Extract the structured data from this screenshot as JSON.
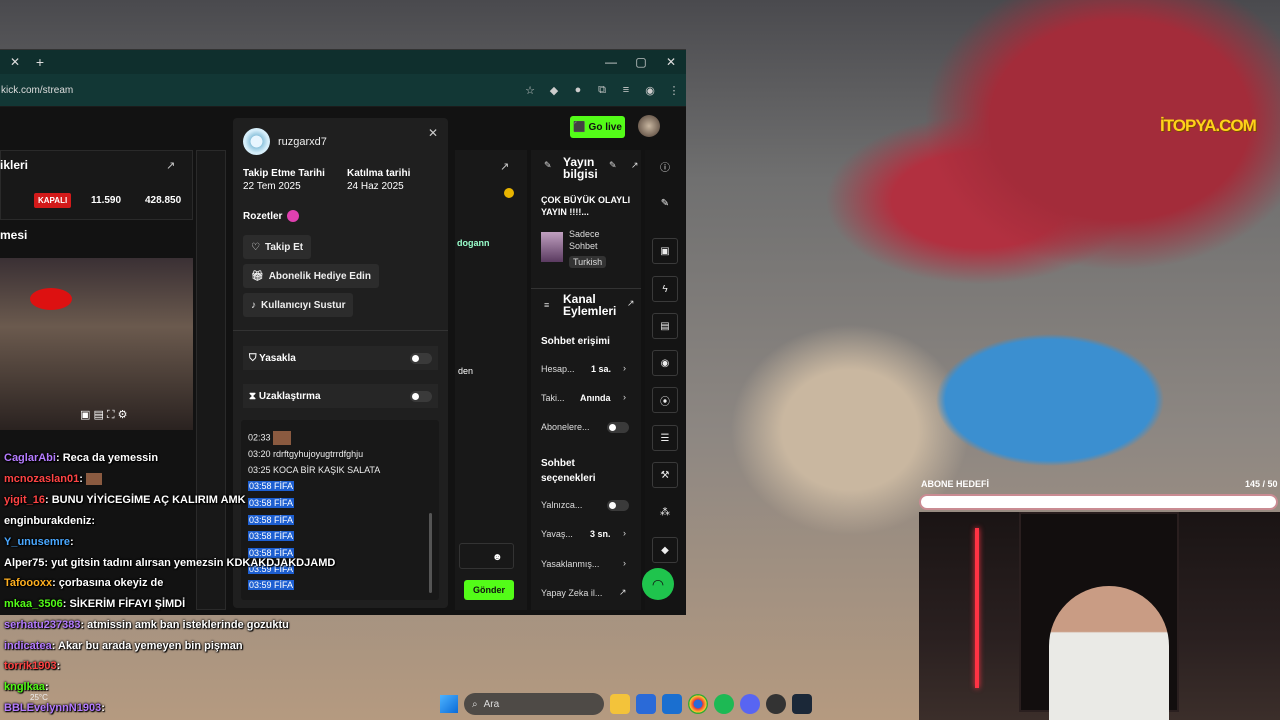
{
  "browser": {
    "url": "kick.com/stream",
    "win_controls": [
      "—",
      "▢",
      "✕"
    ]
  },
  "header": {
    "go_live": "Go live"
  },
  "left": {
    "stats_title": "ikleri",
    "kapali": "KAPALI",
    "stat1": "11.590",
    "stat2": "428.850",
    "preview_title": "mesi"
  },
  "modal": {
    "username": "ruzgarxd7",
    "follow_date_label": "Takip Etme Tarihi",
    "follow_date": "22 Tem 2025",
    "join_date_label": "Katılma tarihi",
    "join_date": "24 Haz 2025",
    "badges_label": "Rozetler",
    "btn_follow": "Takip Et",
    "btn_gift": "Abonelik Hediye Edin",
    "btn_mute": "Kullanıcıyı Sustur",
    "ban_label": "Yasakla",
    "timeout_label": "Uzaklaştırma",
    "log": [
      {
        "t": "02:33",
        "m": ""
      },
      {
        "t": "03:20",
        "m": "rdrftgyhujoyugtrrdfghju"
      },
      {
        "t": "03:25",
        "m": "KOCA BİR KAŞIK SALATA"
      },
      {
        "t": "03:58",
        "m": "FİFA"
      },
      {
        "t": "03:58",
        "m": "FİFA"
      },
      {
        "t": "03:58",
        "m": "FİFA"
      },
      {
        "t": "03:58",
        "m": "FİFA"
      },
      {
        "t": "03:58",
        "m": "FİFA"
      },
      {
        "t": "03:59",
        "m": "FİFA"
      },
      {
        "t": "03:59",
        "m": "FİFA"
      }
    ]
  },
  "mid": {
    "user": "dogann",
    "send": "Gönder",
    "frag": "den"
  },
  "info": {
    "title": "Yayın bilgisi",
    "stream_title": "ÇOK BÜYÜK OLAYLI YAYIN !!!!...",
    "category": "Sadece Sohbet",
    "lang": "Turkish",
    "actions_title": "Kanal Eylemleri",
    "chat_access": "Sohbet erişimi",
    "row1": "Hesap...",
    "row1v": "1 sa.",
    "row2": "Taki...",
    "row2v": "Anında",
    "row3": "Abonelere...",
    "chat_opts": "Sohbet seçenekleri",
    "row4": "Yalnızca...",
    "row5": "Yavaş...",
    "row5v": "3 sn.",
    "row6": "Yasaklanmış...",
    "row7": "Yapay Zeka il..."
  },
  "overlay_chat": [
    {
      "u": "CaglarAbi",
      "m": ": Reca da yemessin",
      "c": "#b57cff"
    },
    {
      "u": "mcnozaslan01",
      "m": ":",
      "c": "#ff4444"
    },
    {
      "u": "yigit_16",
      "m": ": BUNU YİYİCEGİME AÇ KALIRIM AMK",
      "c": "#ff4444"
    },
    {
      "u": "enginburakdeniz",
      "m": ":",
      "c": "#ffffff"
    },
    {
      "u": "Y_unusemre",
      "m": ":",
      "c": "#4aa8ff"
    },
    {
      "u": "Alper75",
      "m": ": yut gitsin tadını alırsan yemezsin KDKAKDJAKDJAMD",
      "c": "#ffffff"
    },
    {
      "u": "Tafoooxx",
      "m": ": çorbasına okeyiz de",
      "c": "#ffb020"
    },
    {
      "u": "mkaa_3506",
      "m": ": SİKERİM FİFAYI ŞİMDİ",
      "c": "#53fc18"
    },
    {
      "u": "serhatu237383",
      "m": ": atmissin amk ban isteklerinde gozuktu",
      "c": "#b57cff"
    },
    {
      "u": "indicatea",
      "m": ": Akar bu arada yemeyen bin pişman",
      "c": "#b57cff"
    },
    {
      "u": "torrik1903",
      "m": ":",
      "c": "#ff4444"
    },
    {
      "u": "knglkaa",
      "m": ":",
      "c": "#53fc18"
    },
    {
      "u": "BBLEvelynnN1903",
      "m": ":",
      "c": "#b57cff"
    }
  ],
  "stream": {
    "logo": "İTOPYA.COM",
    "goal_label": "ABONE HEDEFİ",
    "goal_value": "145 / 50"
  },
  "taskbar": {
    "search": "Ara",
    "temp": "25°C"
  }
}
